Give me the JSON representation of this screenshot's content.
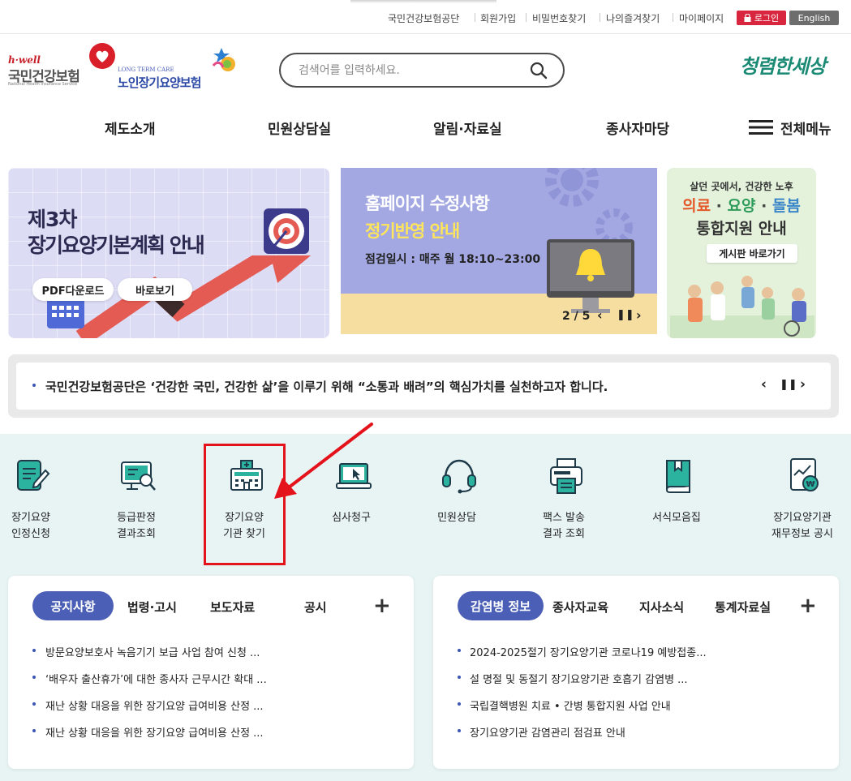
{
  "util_links": [
    "국민건강보험공단",
    "회원가입",
    "비밀번호찾기",
    "나의즐겨찾기",
    "마이페이지"
  ],
  "login_label": "로그인",
  "english_label": "English",
  "logo": {
    "nhis_brand": "h·well",
    "nhis_name": "국민건강보험",
    "nhis_en": "National Health Insurance Service",
    "ltc_en": "LONG TERM CARE",
    "ltc_name": "노인장기요양보험"
  },
  "search": {
    "placeholder": "검색어를 입력하세요."
  },
  "slogan": "청렴한세상",
  "nav": {
    "items": [
      "제도소개",
      "민원상담실",
      "알림·자료실",
      "종사자마당"
    ],
    "all_menu": "전체메뉴"
  },
  "banner1": {
    "title_line1": "제3차",
    "title_line2": "장기요양기본계획 안내",
    "btn_pdf": "PDF다운로드",
    "btn_view": "바로보기"
  },
  "banner2": {
    "title_line1": "홈페이지 수정사항",
    "title_line2": "정기반영 안내",
    "subtitle": "점검일시 : 매주 월 18:10~23:00",
    "pager": "2 / 5"
  },
  "banner3": {
    "line1": "살던 곳에서, 건강한 노후",
    "line2_a": "의료",
    "line2_b": "요양",
    "line2_c": "돌봄",
    "line3": "통합지원 안내",
    "btn": "게시판 바로가기"
  },
  "ticker": {
    "text": "국민건강보험공단은 ‘건강한 국민, 건강한 삶’을 이루기 위해 “소통과 배려”의 핵심가치를 실천하고자 합니다."
  },
  "quick_menu": [
    {
      "label": "장기요양\n인정신청",
      "icon": "document-pen-icon"
    },
    {
      "label": "등급판정\n결과조회",
      "icon": "monitor-search-icon"
    },
    {
      "label": "장기요양\n기관 찾기",
      "icon": "building-icon"
    },
    {
      "label": "심사청구",
      "icon": "laptop-cursor-icon"
    },
    {
      "label": "민원상담",
      "icon": "headset-icon"
    },
    {
      "label": "팩스 발송\n결과 조회",
      "icon": "fax-icon"
    },
    {
      "label": "서식모음집",
      "icon": "book-icon"
    },
    {
      "label": "장기요양기관\n재무정보 공시",
      "icon": "finance-report-icon"
    }
  ],
  "board_left": {
    "tabs": [
      "공지사항",
      "법령·고시",
      "보도자료",
      "공시"
    ],
    "posts": [
      "방문요양보호사 녹음기기 보급 사업 참여 신청 ...",
      "‘배우자 출산휴가’에 대한 종사자 근무시간 확대 ...",
      "재난 상황 대응을 위한 장기요양 급여비용 산정 ...",
      "재난 상황 대응을 위한 장기요양 급여비용 산정 ..."
    ]
  },
  "board_right": {
    "tabs": [
      "감염병 정보",
      "종사자교육",
      "지사소식",
      "통계자료실"
    ],
    "posts": [
      "2024-2025절기 장기요양기관 코로나19 예방접종...",
      "설 명절 및 동절기 장기요양기관 호흡기 감염병 ...",
      "국립결핵병원 치료 • 간병 통합지원 사업 안내",
      "장기요양기관 감염관리 점검표 안내"
    ]
  },
  "colors": {
    "accent": "#4a5fb5",
    "login": "#d7263d",
    "highlight": "#e3121b",
    "icon_teal": "#1a9a8a"
  }
}
